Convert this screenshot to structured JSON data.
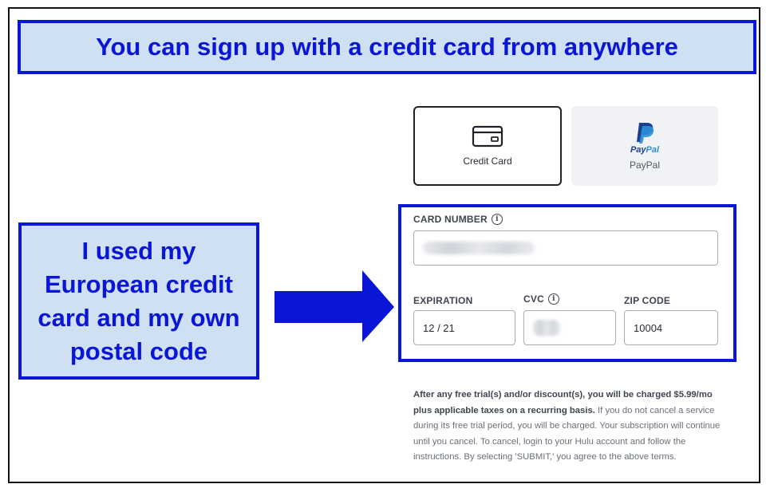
{
  "banner": {
    "text": "You can sign up with a credit card from anywhere"
  },
  "callout": {
    "text": "I used my European credit card and my own postal code"
  },
  "payment_methods": {
    "credit_card": {
      "label": "Credit Card",
      "icon": "credit-card-icon"
    },
    "paypal": {
      "logo_pay": "Pay",
      "logo_pal": "Pal",
      "label": "PayPal",
      "icon": "paypal-icon"
    }
  },
  "form": {
    "card_number": {
      "label": "CARD NUMBER",
      "value": ""
    },
    "expiration": {
      "label": "EXPIRATION",
      "value": "12 / 21"
    },
    "cvc": {
      "label": "CVC",
      "value": ""
    },
    "zip_code": {
      "label": "ZIP CODE",
      "value": "10004"
    }
  },
  "terms": {
    "bold": "After any free trial(s) and/or discount(s), you will be charged $5.99/mo plus applicable taxes on a recurring basis.",
    "rest": " If you do not cancel a service during its free trial period, you will be charged. Your subscription will continue until you cancel. To cancel, login to your Hulu account and follow the instructions. By selecting 'SUBMIT,' you agree to the above terms."
  },
  "colors": {
    "highlight_blue": "#0a16d6",
    "highlight_fill": "#cfe0f3"
  }
}
